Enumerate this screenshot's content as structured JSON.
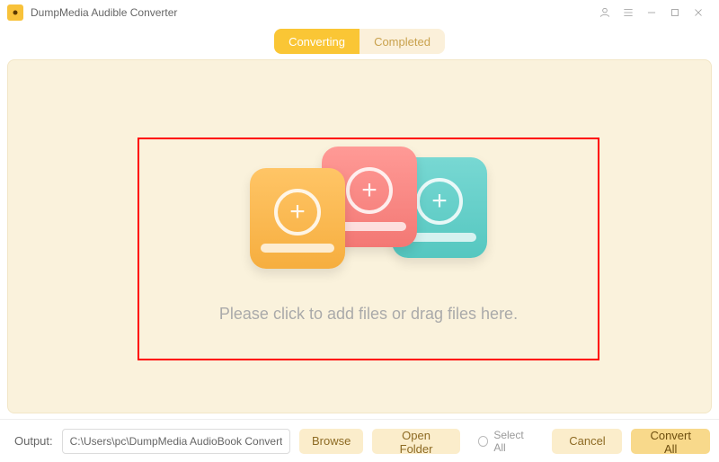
{
  "app": {
    "title": "DumpMedia Audible Converter"
  },
  "tabs": {
    "converting": "Converting",
    "completed": "Completed"
  },
  "dropzone": {
    "message": "Please click to add files or drag files here."
  },
  "footer": {
    "output_label": "Output:",
    "output_path": "C:\\Users\\pc\\DumpMedia AudioBook Converte",
    "browse": "Browse",
    "open_folder": "Open Folder",
    "select_all": "Select All",
    "cancel": "Cancel",
    "convert_all": "Convert All"
  }
}
